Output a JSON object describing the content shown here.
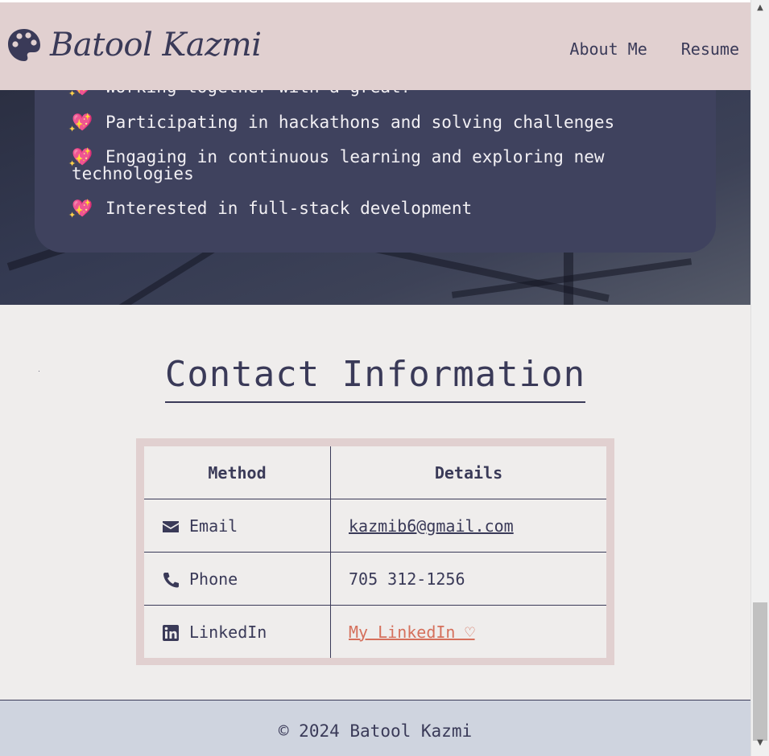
{
  "header": {
    "brand_name": "Batool Kazmi",
    "nav": [
      {
        "label": "About Me"
      },
      {
        "label": "Resume"
      }
    ]
  },
  "interests": {
    "items": [
      {
        "emoji": "💖",
        "text": "Working together with a great?"
      },
      {
        "emoji": "💖",
        "text": "Participating in hackathons and solving challenges"
      },
      {
        "emoji": "💖",
        "text": "Engaging in continuous learning and exploring new technologies"
      },
      {
        "emoji": "💖",
        "text": "Interested in full-stack development"
      }
    ]
  },
  "contact": {
    "title": "Contact Information",
    "table": {
      "headers": [
        "Method",
        "Details"
      ],
      "rows": [
        {
          "method": "Email",
          "icon": "envelope-icon",
          "detail": "kazmib6@gmail.com"
        },
        {
          "method": "Phone",
          "icon": "phone-icon",
          "detail": "705 312-1256"
        },
        {
          "method": "LinkedIn",
          "icon": "linkedin-icon",
          "detail": "My LinkedIn ♡"
        }
      ]
    }
  },
  "footer": {
    "text": "© 2024 Batool Kazmi"
  },
  "colors": {
    "header_bg": "#e1d0d0",
    "accent_navy": "#3a3a58",
    "card_bg": "#3f425e",
    "link_coral": "#d5705c",
    "footer_bg": "#cfd4df",
    "page_bg": "#efedec"
  }
}
